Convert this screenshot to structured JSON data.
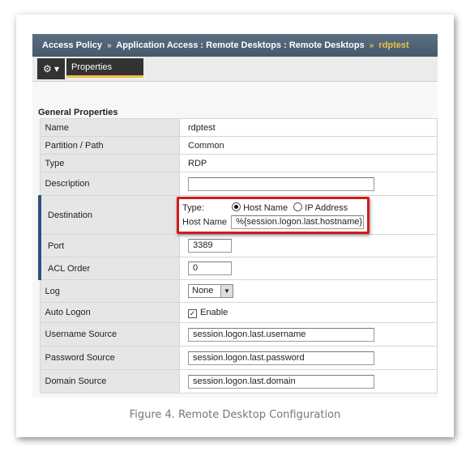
{
  "breadcrumb": {
    "items": [
      "Access Policy",
      "Application Access : Remote Desktops : Remote Desktops"
    ],
    "separator": "»",
    "current": "rdptest"
  },
  "tabs": {
    "gear": "⚙ ▾",
    "properties": "Properties"
  },
  "section_title": "General Properties",
  "fields": {
    "name": {
      "label": "Name",
      "value": "rdptest"
    },
    "partition": {
      "label": "Partition / Path",
      "value": "Common"
    },
    "type": {
      "label": "Type",
      "value": "RDP"
    },
    "description": {
      "label": "Description",
      "value": ""
    },
    "destination": {
      "label": "Destination",
      "type_label": "Type:",
      "option_host": "Host Name",
      "option_ip": "IP Address",
      "host_label": "Host Name",
      "host_value": "%{session.logon.last.hostname}"
    },
    "port": {
      "label": "Port",
      "value": "3389"
    },
    "acl_order": {
      "label": "ACL Order",
      "value": "0"
    },
    "log": {
      "label": "Log",
      "value": "None"
    },
    "auto_logon": {
      "label": "Auto Logon",
      "checkbox_label": "Enable"
    },
    "username_source": {
      "label": "Username Source",
      "value": "session.logon.last.username"
    },
    "password_source": {
      "label": "Password Source",
      "value": "session.logon.last.password"
    },
    "domain_source": {
      "label": "Domain Source",
      "value": "session.logon.last.domain"
    }
  },
  "caption": "Figure 4. Remote Desktop Configuration",
  "colors": {
    "accent": "#f0c040",
    "highlight": "#d21a1a",
    "required_bar": "#2d4f80"
  }
}
